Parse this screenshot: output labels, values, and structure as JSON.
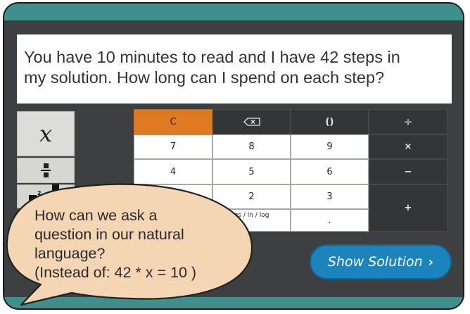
{
  "question": {
    "line1": "You have 10 minutes to read and I have 42 steps in",
    "line2": "my solution. How long can I spend on each step?"
  },
  "function_keys": {
    "variable": "x",
    "fraction_icon": "fraction-icon",
    "power_icon": "power-icon",
    "power_exponent": "2"
  },
  "keypad": {
    "clear": "C",
    "backspace_icon": "backspace-icon",
    "parens": "()",
    "divide": "÷",
    "row1": [
      "7",
      "8",
      "9"
    ],
    "row2": [
      "4",
      "5",
      "6"
    ],
    "row3": [
      "",
      "2",
      "3"
    ],
    "multiply": "×",
    "minus": "−",
    "plus": "+",
    "logs_partial": "gs / ln / log",
    "decimal": "."
  },
  "show_solution": {
    "label": "Show Solution",
    "chevron_icon": "chevron-right-icon"
  },
  "callout": {
    "text": "How can we ask a\nquestion in our natural\nlanguage?\n(Instead of:  42 * x = 10 )"
  },
  "colors": {
    "frame": "#3d3f40",
    "accent_teal": "#3f8f8c",
    "clear_key": "#e07a22",
    "solution_button": "#1b84bd",
    "callout_fill": "#f4d6b4"
  }
}
